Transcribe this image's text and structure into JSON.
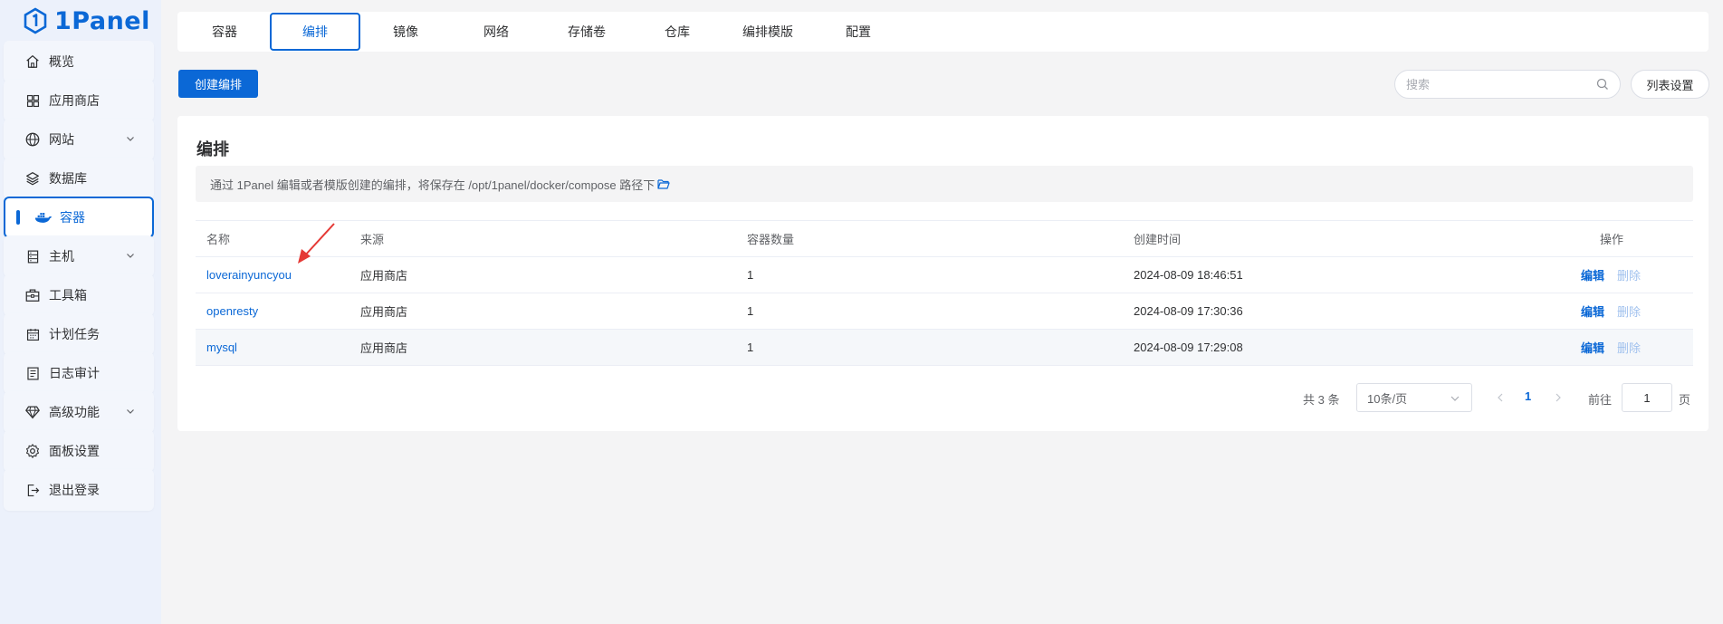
{
  "app": {
    "logo_text": "1Panel"
  },
  "sidebar": {
    "items": [
      {
        "label": "概览",
        "icon": "home-icon",
        "has_chevron": false
      },
      {
        "label": "应用商店",
        "icon": "grid-icon",
        "has_chevron": false
      },
      {
        "label": "网站",
        "icon": "globe-icon",
        "has_chevron": true
      },
      {
        "label": "数据库",
        "icon": "layers-icon",
        "has_chevron": false
      },
      {
        "label": "容器",
        "icon": "docker-icon",
        "has_chevron": false,
        "active": true
      },
      {
        "label": "主机",
        "icon": "server-icon",
        "has_chevron": true
      },
      {
        "label": "工具箱",
        "icon": "toolbox-icon",
        "has_chevron": false
      },
      {
        "label": "计划任务",
        "icon": "calendar-icon",
        "has_chevron": false
      },
      {
        "label": "日志审计",
        "icon": "log-icon",
        "has_chevron": false
      },
      {
        "label": "高级功能",
        "icon": "diamond-icon",
        "has_chevron": true
      },
      {
        "label": "面板设置",
        "icon": "gear-icon",
        "has_chevron": false
      },
      {
        "label": "退出登录",
        "icon": "logout-icon",
        "has_chevron": false
      }
    ]
  },
  "tabs": [
    "容器",
    "编排",
    "镜像",
    "网络",
    "存储卷",
    "仓库",
    "编排模版",
    "配置"
  ],
  "active_tab": "编排",
  "toolbar": {
    "create_label": "创建编排",
    "search_placeholder": "搜索",
    "list_settings_label": "列表设置"
  },
  "panel": {
    "title": "编排",
    "notice": "通过 1Panel 编辑或者模版创建的编排，将保存在 /opt/1panel/docker/compose 路径下"
  },
  "table": {
    "columns": [
      "名称",
      "来源",
      "容器数量",
      "创建时间",
      "操作"
    ],
    "rows": [
      {
        "name": "loverainyuncyou",
        "source": "应用商店",
        "count": "1",
        "created": "2024-08-09 18:46:51",
        "edit": "编辑",
        "delete": "删除"
      },
      {
        "name": "openresty",
        "source": "应用商店",
        "count": "1",
        "created": "2024-08-09 17:30:36",
        "edit": "编辑",
        "delete": "删除"
      },
      {
        "name": "mysql",
        "source": "应用商店",
        "count": "1",
        "created": "2024-08-09 17:29:08",
        "edit": "编辑",
        "delete": "删除"
      }
    ]
  },
  "pagination": {
    "total": "共 3 条",
    "page_size": "10条/页",
    "current_page": "1",
    "goto_label": "前往",
    "goto_value": "1",
    "page_suffix": "页"
  },
  "colors": {
    "accent": "#0b68d6",
    "sidebar_bg": "#ecf1fb",
    "annotation_arrow": "#e53935"
  }
}
